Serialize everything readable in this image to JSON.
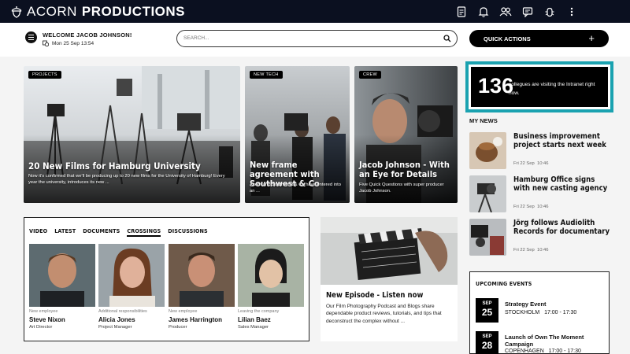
{
  "brand": {
    "name_light": "ACORN",
    "name_bold": "PRODUCTIONS"
  },
  "topbar": {
    "icons": [
      "document-icon",
      "bell-icon",
      "people-icon",
      "chat-icon",
      "bug-icon",
      "more-vertical-icon"
    ]
  },
  "welcome": {
    "greeting": "WELCOME JACOB JOHNSON!",
    "datetime": "Mon 25 Sep 13:54"
  },
  "search": {
    "placeholder": "SEARCH..."
  },
  "quick_actions": {
    "label": "QUICK ACTIONS",
    "plus": "+"
  },
  "hero": [
    {
      "tag": "PROJECTS",
      "title": "20 New Films for Hamburg University",
      "desc": "Now it's confirmed that we'll be producing up to 20 new films for the University of Hamburg! Every year the university, introduces its new ..."
    },
    {
      "tag": "NEW TECH",
      "title": "New frame agreement with Southwest & Co",
      "desc": "Acorn and Southwest & Co have entered into an ..."
    },
    {
      "tag": "CREW",
      "title": "Jacob Johnson - With an Eye for Details",
      "desc": "Five Quick Questions with super producer Jacob Johnson."
    }
  ],
  "online": {
    "count": "136",
    "text": "collegues are visiting the Intranet right now."
  },
  "my_news": {
    "heading": "MY NEWS",
    "items": [
      {
        "title": "Business improvement project starts next week",
        "date": "Fri 22 Sep",
        "time": "10:46"
      },
      {
        "title": "Hamburg Office signs with new casting agency",
        "date": "Fri 22 Sep",
        "time": "10:46"
      },
      {
        "title": "Jörg follows Audiolith Records for documentary",
        "date": "Fri 22 Sep",
        "time": "10:46"
      }
    ]
  },
  "people_tabs": {
    "tabs": [
      "VIDEO",
      "LATEST",
      "DOCUMENTS",
      "CROSSINGS",
      "DISCUSSIONS"
    ],
    "active": "CROSSINGS",
    "people": [
      {
        "status": "New employee",
        "name": "Steve Nixon",
        "job": "Art Director"
      },
      {
        "status": "Additional responsibilities",
        "name": "Alicia Jones",
        "job": "Project Manager"
      },
      {
        "status": "New employee",
        "name": "James Harrington",
        "job": "Producer"
      },
      {
        "status": "Leaving the company",
        "name": "Lilian Baez",
        "job": "Sales Manager"
      }
    ]
  },
  "podcast": {
    "title": "New Episode - Listen now",
    "desc": "Our Film Photography Podcast and Blogs share dependable product reviews, tutorials, and tips that deconstruct the complex without ..."
  },
  "events": {
    "heading": "UPCOMING EVENTS",
    "items": [
      {
        "month": "SEP",
        "day": "25",
        "name": "Strategy Event",
        "place": "STOCKHOLM",
        "time": "17:00 - 17:30"
      },
      {
        "month": "SEP",
        "day": "28",
        "name": "Launch of Own The Moment Campaign",
        "place": "COPENHAGEN",
        "time": "17:00 - 17:30"
      }
    ]
  },
  "colors": {
    "topbar": "#0b1020",
    "accent_teal": "#1aa2b0",
    "black": "#000000"
  }
}
